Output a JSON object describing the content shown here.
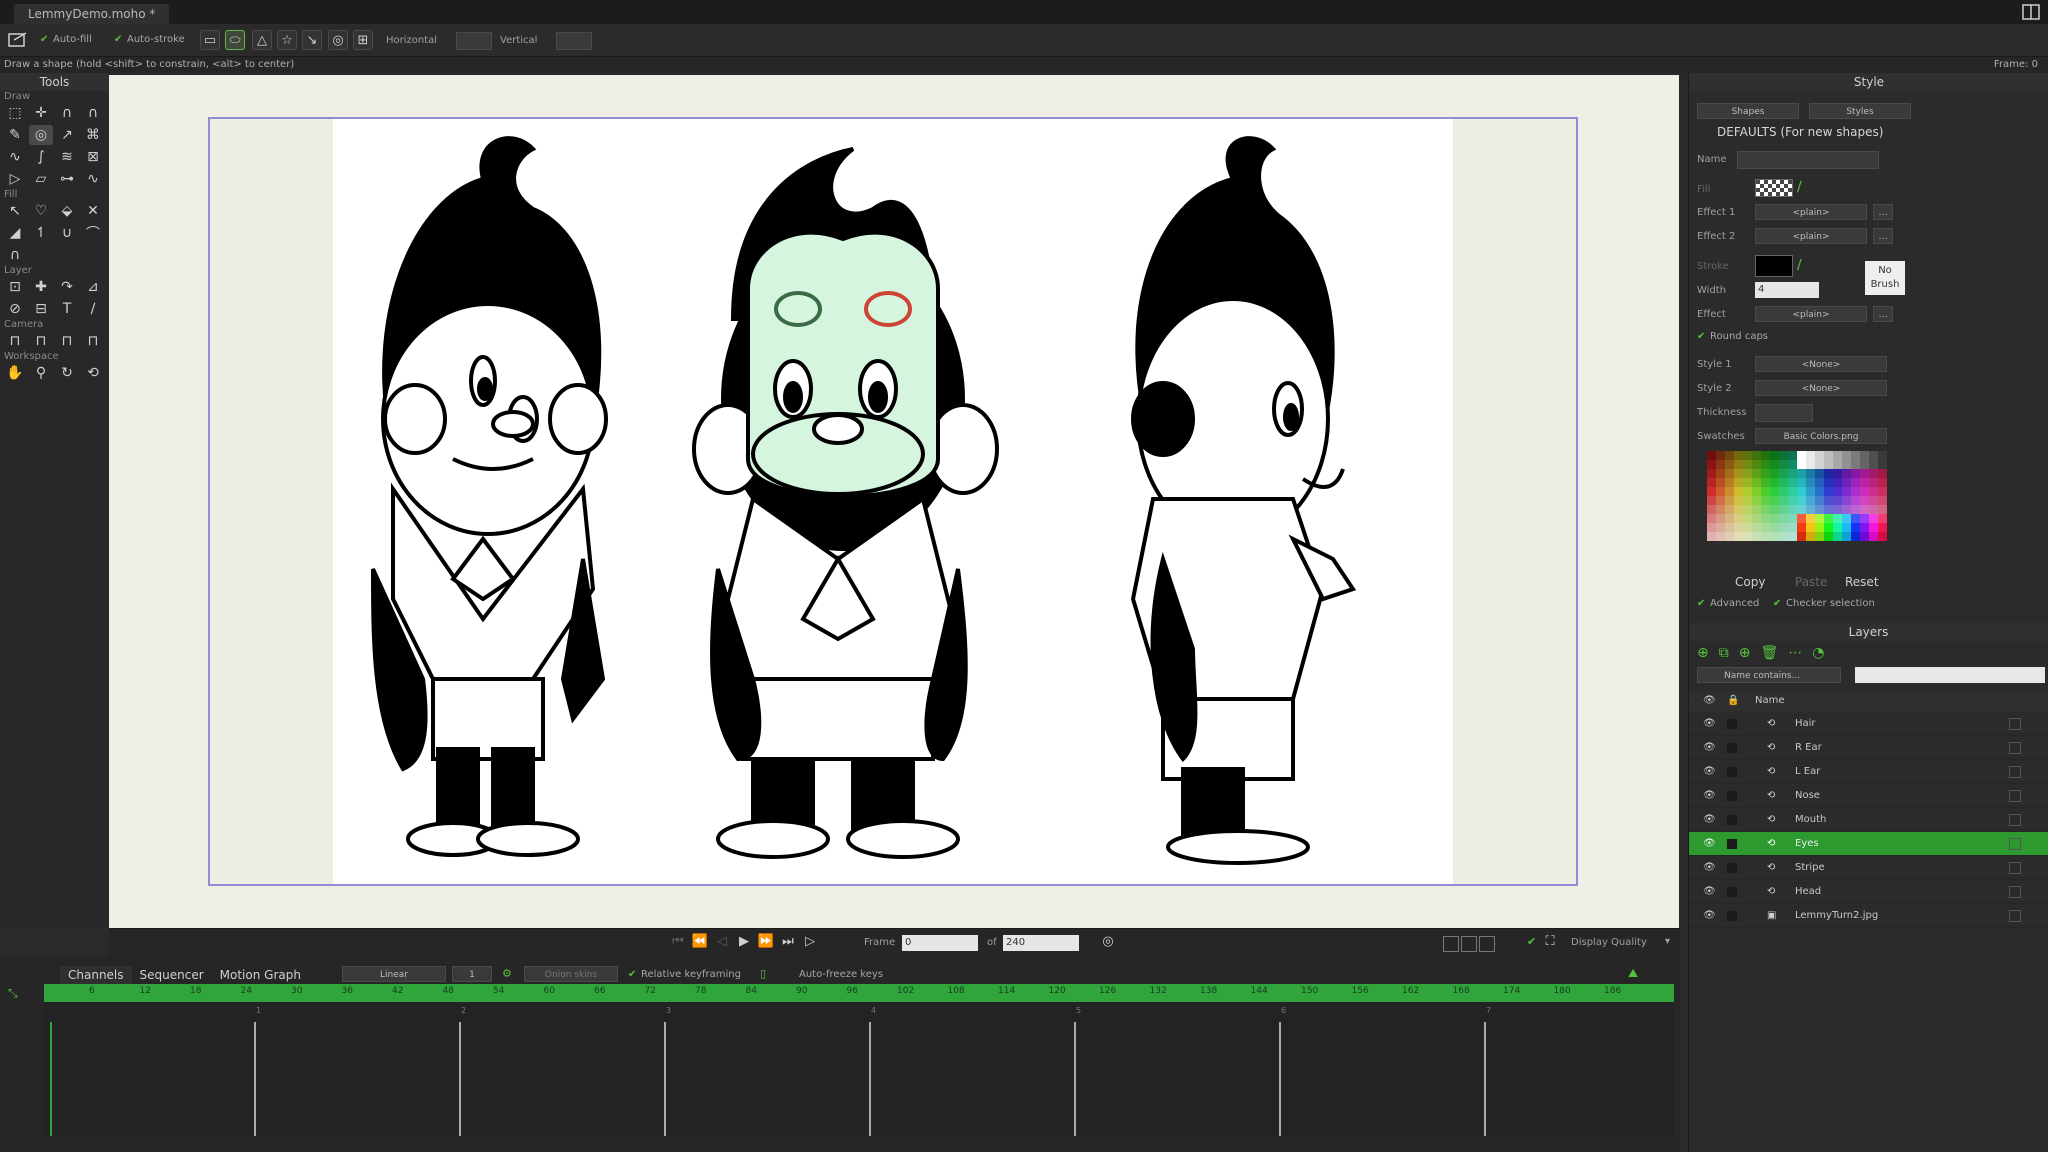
{
  "window": {
    "doc_tab": "LemmyDemo.moho *"
  },
  "toolbar": {
    "auto_fill": "Auto-fill",
    "auto_stroke": "Auto-stroke",
    "horizontal": "Horizontal",
    "vertical": "Vertical",
    "status": "Draw a shape (hold <shift> to constrain, <alt> to center)",
    "frame_indicator": "Frame: 0"
  },
  "tools_panel": {
    "title": "Tools",
    "sections": [
      "Draw",
      "Fill",
      "Layer",
      "Camera",
      "Workspace"
    ]
  },
  "transport": {
    "frame_label": "Frame",
    "frame_value": "0",
    "of_label": "of",
    "total_frames": "240",
    "display_quality": "Display Quality"
  },
  "timeline": {
    "tabs": [
      "Channels",
      "Sequencer",
      "Motion Graph"
    ],
    "interp": "Linear",
    "interp_num": "1",
    "onion_skins": "Onion skins",
    "relative_keyframing": "Relative keyframing",
    "auto_freeze": "Auto-freeze keys",
    "ruler_ticks": [
      "6",
      "12",
      "18",
      "24",
      "30",
      "36",
      "42",
      "48",
      "54",
      "60",
      "66",
      "72",
      "78",
      "84",
      "90",
      "96",
      "102",
      "108",
      "114",
      "120",
      "126",
      "132",
      "138",
      "144",
      "150",
      "156",
      "162",
      "168",
      "174",
      "180",
      "186"
    ],
    "second_markers": [
      "1",
      "2",
      "3",
      "4",
      "5",
      "6",
      "7"
    ]
  },
  "style_panel": {
    "title": "Style",
    "shapes_dd": "Shapes",
    "styles_dd": "Styles",
    "defaults": "DEFAULTS (For new shapes)",
    "name_label": "Name",
    "fill_label": "Fill",
    "effect1_label": "Effect 1",
    "effect1_value": "<plain>",
    "effect2_label": "Effect 2",
    "effect2_value": "<plain>",
    "stroke_label": "Stroke",
    "width_label": "Width",
    "width_value": "4",
    "effect_label": "Effect",
    "effect_value": "<plain>",
    "no_brush": "No Brush",
    "round_caps": "Round caps",
    "style1_label": "Style 1",
    "style1_value": "<None>",
    "style2_label": "Style 2",
    "style2_value": "<None>",
    "thickness_label": "Thickness",
    "swatches_label": "Swatches",
    "swatches_value": "Basic Colors.png",
    "copy": "Copy",
    "paste": "Paste",
    "reset": "Reset",
    "advanced": "Advanced",
    "checker_selection": "Checker selection",
    "colors": {
      "accent": "#2c9a2e",
      "stage_border": "#8f8dd6",
      "ruler": "#2fa53c"
    }
  },
  "layers_panel": {
    "title": "Layers",
    "filter_dd": "Name contains...",
    "name_header": "Name",
    "layers": [
      {
        "name": "Hair",
        "icon": "bone-layer-icon",
        "selected": false
      },
      {
        "name": "R Ear",
        "icon": "bone-layer-icon",
        "selected": false
      },
      {
        "name": "L Ear",
        "icon": "bone-layer-icon",
        "selected": false
      },
      {
        "name": "Nose",
        "icon": "bone-layer-icon",
        "selected": false
      },
      {
        "name": "Mouth",
        "icon": "bone-layer-icon",
        "selected": false
      },
      {
        "name": "Eyes",
        "icon": "bone-layer-icon",
        "selected": true
      },
      {
        "name": "Stripe",
        "icon": "bone-layer-icon",
        "selected": false
      },
      {
        "name": "Head",
        "icon": "bone-layer-icon",
        "selected": false
      },
      {
        "name": "LemmyTurn2.jpg",
        "icon": "image-layer-icon",
        "selected": false
      }
    ]
  }
}
